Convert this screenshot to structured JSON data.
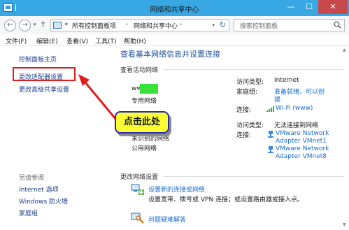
{
  "window": {
    "title": "网络和共享中心",
    "minimize": "—",
    "maximize": "☐",
    "close": "✕"
  },
  "nav": {
    "back": "←",
    "forward": "→",
    "up": "↑",
    "dropdown": "▾"
  },
  "address": {
    "overflow": "«",
    "crumbs": [
      "所有控制面板项",
      "网络和共享中心"
    ],
    "separator": "›",
    "dropdown": "▾",
    "refresh": "↻"
  },
  "search": {
    "placeholder": "搜索控制面板"
  },
  "menu": [
    "文件(F)",
    "编辑(E)",
    "查看(V)",
    "工具(T)",
    "帮助(H)"
  ],
  "sidebar": {
    "links": [
      "控制面板主页",
      "更改适配器设置",
      "更改高级共享设置"
    ],
    "see_also_heading": "另请参阅",
    "see_also": [
      "Internet 选项",
      "Windows 防火墙",
      "家庭组"
    ]
  },
  "main": {
    "title": "查看基本网络信息并设置连接",
    "active_networks_label": "查看活动网络",
    "network1": {
      "name": "ww",
      "type": "专用网络",
      "access_type_label": "访问类型:",
      "access_type": "Internet",
      "homegroup_label": "家庭组:",
      "homegroup_line1": "准备就绪，可以创",
      "homegroup_line2": "建",
      "connection_label": "连接:",
      "connection": "Wi-Fi (www)"
    },
    "network2": {
      "name": "未识别的网络",
      "type": "公用网络",
      "access_type_label": "访问类型:",
      "access_type": "无法连接到网络",
      "connection_label": "连接:",
      "adapters": [
        [
          "VMware Network",
          "Adapter VMnet1"
        ],
        [
          "VMware Network",
          "Adapter VMnet8"
        ]
      ]
    },
    "change_settings_label": "更改网络设置",
    "tasks": [
      {
        "link": "设置新的连接或网络",
        "desc": "设置宽带、拨号或 VPN 连接；或设置路由器或接入点。",
        "icon": "new-connection-icon"
      },
      {
        "link": "问题疑难解答",
        "icon": "troubleshoot-icon"
      }
    ]
  },
  "callout": {
    "text": "点击此处"
  },
  "colors": {
    "titlebar": "#38a8e4",
    "link": "#1a6bd0",
    "highlight_border": "#e01c1c",
    "callout_fill": "#fbff34",
    "callout_border": "#2b2ba6",
    "redaction": "#39e239"
  },
  "scroll": {
    "up": "▲",
    "down": "▼"
  }
}
